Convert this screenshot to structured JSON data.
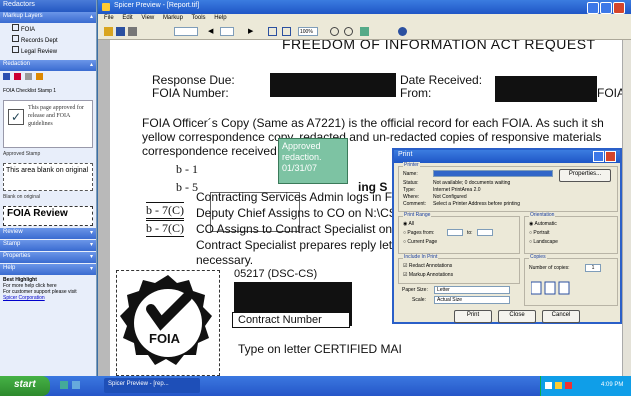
{
  "left_pane": {
    "header": "Redactors",
    "markup_layers": "Markup Layers",
    "layers": [
      "FOIA",
      "Records Dept",
      "Legal Review"
    ],
    "redaction_header": "Redaction",
    "checklist_label": "FOIA Checklist Stamp 1",
    "stamp_text": "This page approved for release and FOIA guidelines",
    "approved_stamp": "Approved Stamp",
    "blank_box": "This area blank on original",
    "blank_caption": "Blank on original",
    "review_stamp": "FOIA Review",
    "sections": [
      "Review",
      "Stamp",
      "Properties",
      "Help"
    ],
    "help_title": "Best Highlight",
    "help_lines": [
      "For more help click here",
      "For customer support please visit"
    ],
    "help_link": "Spicer Corporation"
  },
  "window": {
    "title": "Spicer Preview - [Report.tif]",
    "menu": [
      "File",
      "Edit",
      "View",
      "Markup",
      "Tools",
      "Help"
    ],
    "zoom": "100%"
  },
  "document": {
    "heading": "FREEDOM OF INFORMATION ACT REQUEST",
    "response_due": "Response Due:",
    "foia_number": "FOIA Number:",
    "date_received": "Date Received:",
    "from": "From:",
    "foia_tail": "FOIA",
    "para1": "FOIA Officer´s Copy (Same as A7221) is the official record for each FOIA.  As such it sh",
    "para2": "yellow correspondence copy, redacted and un-redacted copies of responsive materials",
    "para3": "correspondence received                       or.",
    "b1": "b - 1",
    "b5": "b - 5",
    "b7c_1": "b - 7(C)",
    "b7c_2": "b - 7(C)",
    "ing": "ing S",
    "line1": "Contracting Services Admin logs in FOI",
    "line2": "Deputy Chief Assigns to CO on N:\\CS\\F",
    "line3": "CO Assigns to Contract Specialist on N:",
    "line4": "Contract Specialist prepares reply letter",
    "line5": "necessary.",
    "code": "05217 (DSC-CS)",
    "contract_number": "Contract Number",
    "type_on_letter": "Type on letter CERTIFIED MAI",
    "foia_seal": "FOIA"
  },
  "note": {
    "text": "Approved redaction. 01/31/07"
  },
  "print_dialog": {
    "title": "Print",
    "printer_group": "Printer",
    "name_label": "Name:",
    "status_label": "Status:",
    "status_value": "Not available; 0 documents waiting",
    "type_label": "Type:",
    "type_value": "Internet PrintArea 2.0",
    "where_label": "Where:",
    "where_value": "Not Configured",
    "comment_label": "Comment:",
    "comment_value": "Select a Printer Address before printing",
    "properties_btn": "Properties...",
    "range_group": "Print Range",
    "range_all": "All",
    "range_pages": "Pages",
    "range_from": "from:",
    "range_to": "to:",
    "range_current": "Current Page",
    "orient_group": "Orientation",
    "orient_auto": "Automatic",
    "orient_portrait": "Portrait",
    "orient_landscape": "Landscape",
    "include_group": "Include In Print",
    "inc_redact": "Redact Annotations",
    "inc_markup": "Markup Annotations",
    "copies_group": "Copies",
    "copies_label": "Number of copies:",
    "copies_value": "1",
    "paper_size_label": "Paper Size:",
    "paper_size_value": "Letter",
    "scale_label": "Scale:",
    "scale_value": "Actual Size",
    "btn_print": "Print",
    "btn_close": "Close",
    "btn_cancel": "Cancel"
  },
  "taskbar": {
    "start": "start",
    "task": "Spicer Preview - [rep...",
    "clock": "4:09 PM"
  }
}
